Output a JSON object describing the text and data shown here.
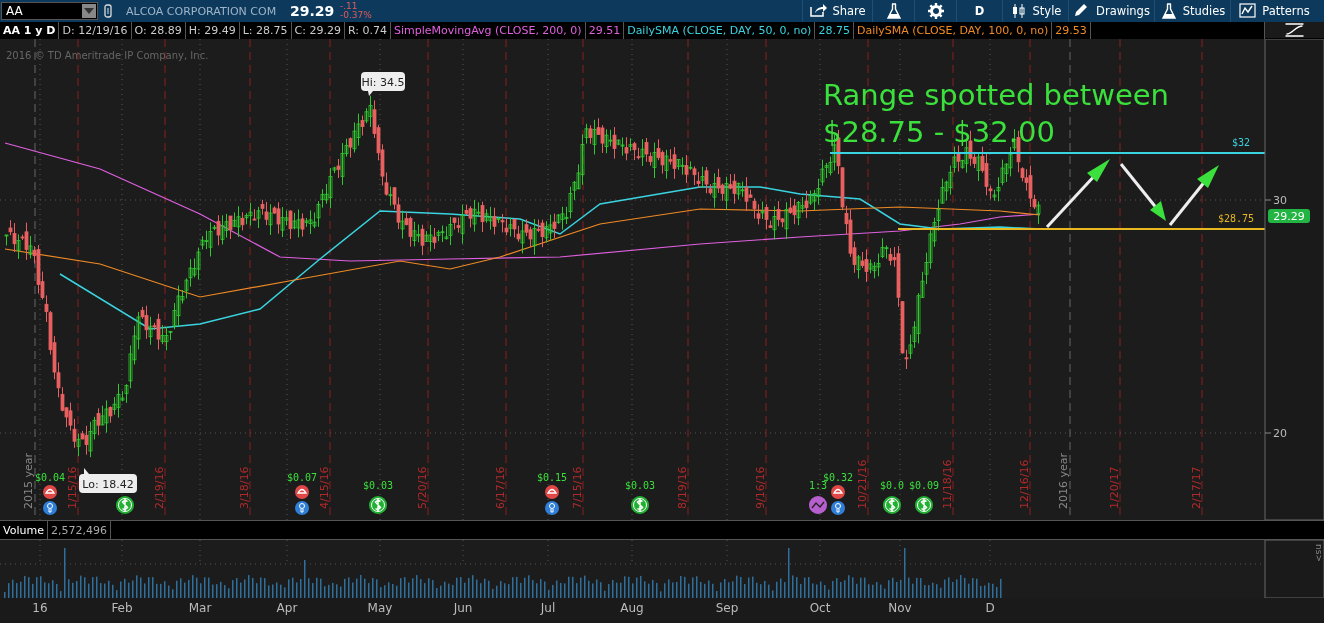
{
  "toolbar": {
    "symbol": "AA",
    "company": "ALCOA CORPORATION COM",
    "last": "29.29",
    "change": "-.11",
    "change_percent": "-0.37%",
    "buttons": [
      {
        "kind": "share",
        "label": "Share"
      },
      {
        "kind": "flask"
      },
      {
        "kind": "gear"
      },
      {
        "kind": "period",
        "label": "D"
      },
      {
        "kind": "style",
        "label": "Style"
      },
      {
        "kind": "drawings",
        "label": "Drawings"
      },
      {
        "kind": "studies",
        "label": "Studies"
      },
      {
        "kind": "patterns",
        "label": "Patterns"
      }
    ]
  },
  "info_bar": {
    "title": "AA 1 y D",
    "fields": [
      "D: 12/19/16",
      "O: 28.89",
      "H: 29.49",
      "L: 28.75",
      "C: 29.29",
      "R: 0.74"
    ],
    "studies": [
      {
        "name": "SimpleMovingAvg (CLOSE, 200, 0)",
        "value": "29.51",
        "color": "#e060e0"
      },
      {
        "name": "DailySMA (CLOSE, DAY, 50, 0, no)",
        "value": "28.75",
        "color": "#3ad4e0"
      },
      {
        "name": "DailySMA (CLOSE, DAY, 100, 0, no)",
        "value": "29.53",
        "color": "#f08a24"
      }
    ]
  },
  "chart": {
    "copyright": "2016 © TD Ameritrade IP Company, Inc.",
    "headline": [
      "Range spotted between",
      "$28.75 - $32.00"
    ],
    "y_ticks": [
      "30",
      "20"
    ],
    "last_price": "29.29",
    "levels": [
      {
        "label": "$32",
        "color": "#3ad4e0"
      },
      {
        "label": "$28.75",
        "color": "#e8b820"
      }
    ],
    "high_label": "Hi: 34.5",
    "low_label": "Lo: 18.42",
    "year_markers": [
      "2015 year",
      "2016 year"
    ],
    "expiry_dates": [
      "1/15/16",
      "2/19/16",
      "3/18/16",
      "4/15/16",
      "5/20/16",
      "6/17/16",
      "7/15/16",
      "8/19/16",
      "9/16/16",
      "10/21/16",
      "11/18/16",
      "12/16/16",
      "1/20/17",
      "2/17/17"
    ],
    "events": [
      {
        "kind": "earnings",
        "amount": "$0.04"
      },
      {
        "kind": "dividend"
      },
      {
        "kind": "earnings",
        "amount": "$0.07"
      },
      {
        "kind": "dividend",
        "amount": "$0.03"
      },
      {
        "kind": "earnings",
        "amount": "$0.15"
      },
      {
        "kind": "dividend",
        "amount": "$0.03"
      },
      {
        "kind": "split",
        "amount": "1:3"
      },
      {
        "kind": "earnings",
        "amount": "$0.32"
      },
      {
        "kind": "dividend",
        "amount": "$0.0"
      },
      {
        "kind": "dividend",
        "amount": "$0.09"
      }
    ]
  },
  "volume": {
    "label": "Volume",
    "value": "2,572,496"
  },
  "months": [
    "16",
    "Feb",
    "Mar",
    "Apr",
    "May",
    "Jun",
    "Jul",
    "Aug",
    "Sep",
    "Oct",
    "Nov",
    "D"
  ],
  "side_tab": "ns>"
}
